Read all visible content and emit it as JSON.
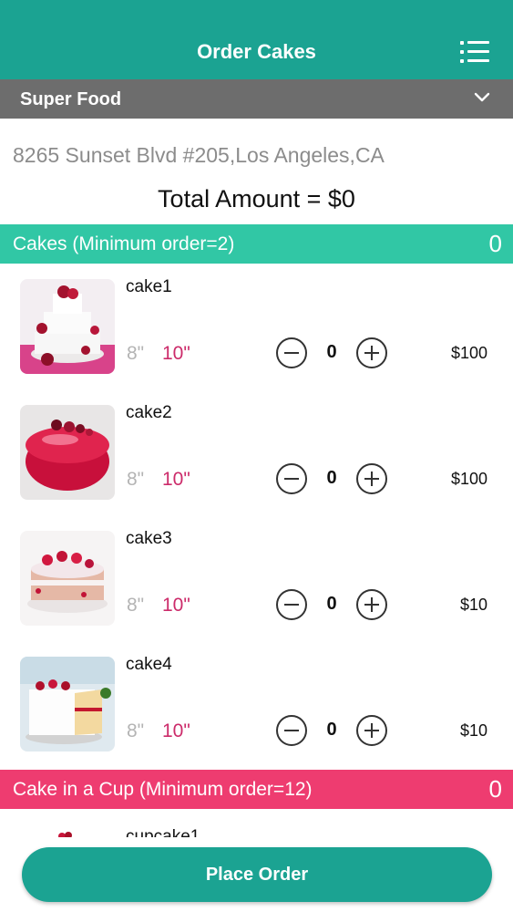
{
  "header": {
    "title": "Order Cakes",
    "menu_icon": "list-menu-icon"
  },
  "store": {
    "name": "Super Food",
    "dropdown_icon": "chevron-down-icon"
  },
  "address": "8265 Sunset Blvd #205,Los Angeles,CA",
  "total": "Total Amount = $0",
  "sections": [
    {
      "title": "Cakes (Minimum order=2)",
      "count": "0",
      "color": "#31c7a5",
      "items": [
        {
          "name": "cake1",
          "size_small": "8\"",
          "size_large": "10\"",
          "qty": "0",
          "price": "$100"
        },
        {
          "name": "cake2",
          "size_small": "8\"",
          "size_large": "10\"",
          "qty": "0",
          "price": "$100"
        },
        {
          "name": "cake3",
          "size_small": "8\"",
          "size_large": "10\"",
          "qty": "0",
          "price": "$10"
        },
        {
          "name": "cake4",
          "size_small": "8\"",
          "size_large": "10\"",
          "qty": "0",
          "price": "$10"
        }
      ]
    },
    {
      "title": "Cake in a Cup (Minimum order=12)",
      "count": "0",
      "color": "#ee3c70",
      "items": [
        {
          "name": "cupcake1"
        }
      ]
    }
  ],
  "footer": {
    "place_order_label": "Place Order"
  },
  "colors": {
    "primary": "#1ba392",
    "store_bar": "#6d6d6d",
    "selected_size": "#cc2b6a",
    "unselected_size": "#b4b4b4"
  }
}
